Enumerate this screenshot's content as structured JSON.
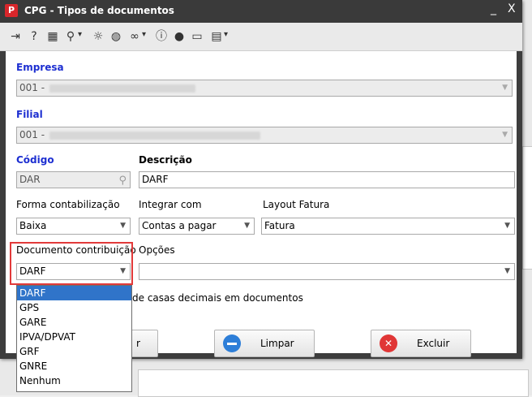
{
  "window": {
    "title": "CPG - Tipos de documentos",
    "minimize": "_",
    "close": "X"
  },
  "toolbar": {
    "icons": [
      "exit-icon",
      "help-icon",
      "keyboard-icon",
      "zoom-icon",
      "lightbulb-icon",
      "world-icon",
      "link-icon",
      "info-icon",
      "user-icon",
      "document-icon",
      "report-icon"
    ]
  },
  "form": {
    "empresa": {
      "label": "Empresa",
      "value": "001 -"
    },
    "filial": {
      "label": "Filial",
      "value": "001 -"
    },
    "codigo": {
      "label": "Código",
      "value": "DAR"
    },
    "descricao": {
      "label": "Descrição",
      "value": "DARF"
    },
    "forma_contabilizacao": {
      "label": "Forma contabilização",
      "value": "Baixa"
    },
    "integrar_com": {
      "label": "Integrar com",
      "value": "Contas a pagar"
    },
    "layout_fatura": {
      "label": "Layout Fatura",
      "value": "Fatura"
    },
    "documento_contribuicao": {
      "label": "Documento contribuição",
      "value": "DARF"
    },
    "opcoes": {
      "label": "Opções",
      "value": ""
    },
    "checkbox_text": "de casas decimais em documentos"
  },
  "dropdown": {
    "options": [
      "DARF",
      "GPS",
      "GARE",
      "IPVA/DPVAT",
      "GRF",
      "GNRE",
      "Nenhum"
    ],
    "selected": "DARF"
  },
  "buttons": {
    "partial_label": "r",
    "limpar": "Limpar",
    "excluir": "Excluir"
  },
  "colors": {
    "title_bar": "#3a3a3a",
    "label_blue": "#1d2fd1",
    "highlight": "#e23a3a",
    "selection": "#3074c9"
  }
}
